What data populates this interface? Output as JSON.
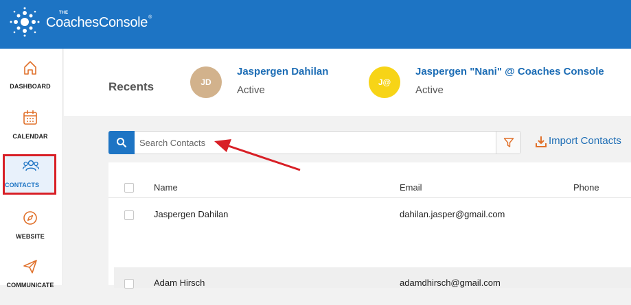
{
  "header": {
    "logo_small": "THE",
    "logo_text": "CoachesConsole",
    "logo_reg": "®"
  },
  "sidebar": {
    "items": [
      {
        "label": "DASHBOARD",
        "icon": "home-icon"
      },
      {
        "label": "CALENDAR",
        "icon": "calendar-icon"
      },
      {
        "label": "CONTACTS",
        "icon": "contacts-icon",
        "active": true
      },
      {
        "label": "WEBSITE",
        "icon": "compass-icon"
      },
      {
        "label": "COMMUNICATE",
        "icon": "send-icon"
      }
    ]
  },
  "recents": {
    "title": "Recents",
    "people": [
      {
        "initials": "JD",
        "name": "Jaspergen Dahilan",
        "status": "Active",
        "avatar_color": "#d2b28c"
      },
      {
        "initials": "J@",
        "name": "Jaspergen \"Nani\" @ Coaches Console",
        "status": "Active",
        "avatar_color": "#f7d417"
      }
    ]
  },
  "search": {
    "placeholder": "Search Contacts",
    "value": ""
  },
  "import": {
    "label": "Import Contacts"
  },
  "table": {
    "columns": [
      "Name",
      "Email",
      "Phone"
    ],
    "rows": [
      {
        "name": "Jaspergen Dahilan",
        "email": "dahilan.jasper@gmail.com",
        "phone": ""
      },
      {
        "name": "Adam Hirsch",
        "email": "adamdhirsch@gmail.com",
        "phone": ""
      }
    ]
  },
  "colors": {
    "brand_blue": "#1d74c4",
    "link_blue": "#1d6db5",
    "icon_orange": "#e0702a",
    "highlight_red": "#d81f26"
  }
}
